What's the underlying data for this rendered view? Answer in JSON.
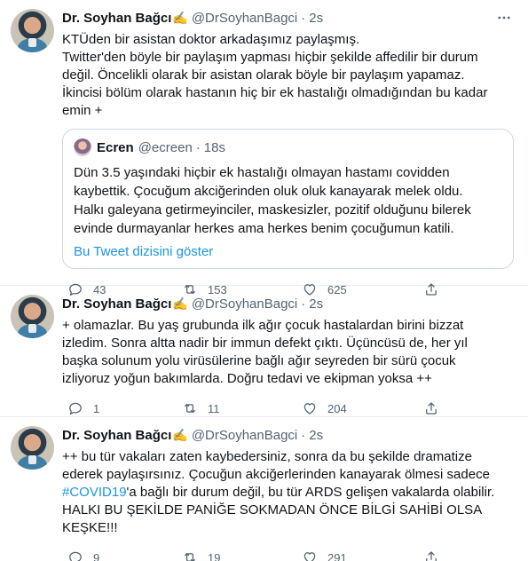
{
  "tweets": [
    {
      "author": "Dr. Soyhan Bağcı",
      "badge": "✍",
      "handle": "@DrSoyhanBagci",
      "time": "2s",
      "lines": [
        "KTÜden bir asistan doktor arkadaşımız paylaşmış.",
        "Twitter'den böyle bir paylaşım yapması hiçbir şekilde affedilir bir durum",
        "değil. Öncelikli olarak bir asistan olarak böyle bir paylaşım yapamaz.",
        "İkincisi bölüm olarak hastanın hiç bir ek hastalığı olmadığından bu kadar",
        "emin +"
      ],
      "quote": {
        "name": "Ecren",
        "handle": "@ecreen",
        "time": "18s",
        "lines": [
          "Dün 3.5 yaşındaki hiçbir ek hastalığı olmayan hastamı covidden",
          "kaybettik. Çocuğum akciğerinden oluk oluk kanayarak melek oldu.",
          "Halkı galeyana getirmeyinciler, maskesizler, pozitif olduğunu bilerek",
          "evinde durmayanlar herkes ama herkes benim çocuğumun katili."
        ],
        "thread_link": "Bu Tweet dizisini göster"
      },
      "replies": "43",
      "retweets": "153",
      "likes": "625"
    },
    {
      "author": "Dr. Soyhan Bağcı",
      "badge": "✍",
      "handle": "@DrSoyhanBagci",
      "time": "2s",
      "lines": [
        "+ olamazlar. Bu yaş grubunda ilk ağır çocuk hastalardan birini bizzat",
        "izledim. Sonra altta nadir bir immun defekt çıktı. Üçüncüsü de, her yıl",
        "başka solunum yolu virüsülerine bağlı ağır seyreden bir sürü çocuk",
        "izliyoruz yoğun bakımlarda. Doğru tedavi ve ekipman yoksa ++"
      ],
      "replies": "1",
      "retweets": "11",
      "likes": "204"
    },
    {
      "author": "Dr. Soyhan Bağcı",
      "badge": "✍",
      "handle": "@DrSoyhanBagci",
      "time": "2s",
      "lines": [
        "++ bu tür vakaları zaten kaybedersiniz, sonra da bu şekilde dramatize",
        "ederek paylaşırsınız. Çocuğun akciğerlerinden kanayarak ölmesi sadece"
      ],
      "hashtag": "#COVID19",
      "hashtag_rest": "'a bağlı bir durum değil, bu tür ARDS gelişen vakalarda olabilir.",
      "lines_after": [
        "HALKI BU ŞEKİLDE PANİĞE SOKMADAN ÖNCE BİLGİ SAHİBİ OLSA",
        "KEŞKE!!!"
      ],
      "replies": "9",
      "retweets": "19",
      "likes": "291"
    }
  ],
  "icons": {
    "more": "more-icon",
    "reply": "reply-icon",
    "retweet": "retweet-icon",
    "like": "heart-icon",
    "share": "share-icon"
  },
  "colors": {
    "link": "#1b95e0",
    "muted": "#536471",
    "border": "#e6ecf0"
  }
}
